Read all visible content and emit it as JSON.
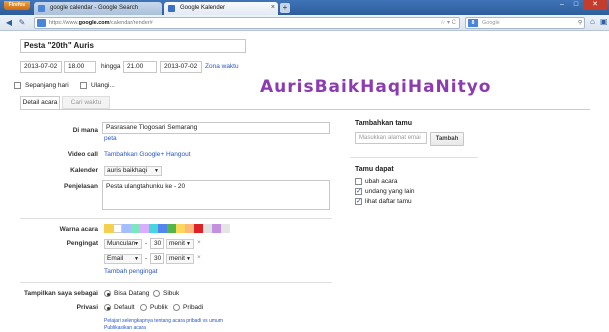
{
  "browser": {
    "firefox_label": "Firefox",
    "tabs": [
      {
        "title": "google calendar - Google Search"
      },
      {
        "title": "Google Kalender"
      }
    ],
    "url_prefix": "https://www.",
    "url_domain": "google.com",
    "url_path": "/calendar/render#",
    "search_placeholder": "Google",
    "search_engine_letter": "8"
  },
  "event": {
    "title": "Pesta \"20th\" Auris",
    "start_date": "2013-07-02",
    "start_time": "18.00",
    "until_label": "hingga",
    "end_time": "21.00",
    "end_date": "2013-07-02",
    "timezone_link": "Zona waktu",
    "allday_label": "Sepanjang hari",
    "repeat_label": "Ulangi...",
    "watermark": "AurisBaikHaqiHaNityo"
  },
  "tabs": {
    "details": "Detail acara",
    "findtime": "Cari waktu"
  },
  "details": {
    "where_label": "Di mana",
    "where_value": "Pasrasane Tlogosari Semarang",
    "map_link": "peta",
    "video_label": "Video call",
    "video_link": "Tambahkan Google+ Hangout",
    "calendar_label": "Kalender",
    "calendar_value": "auris baikhaqi",
    "description_label": "Penjelasan",
    "description_value": "Pesta ulangtahunku ke - 20",
    "color_label": "Warna acara",
    "reminder_label": "Pengingat",
    "reminders": [
      {
        "type": "Munculan",
        "amount": "30",
        "unit": "menit"
      },
      {
        "type": "Email",
        "amount": "30",
        "unit": "menit"
      }
    ],
    "add_reminder_link": "Tambah pengingat",
    "show_as_label": "Tampilkan saya sebagai",
    "show_available": "Bisa Datang",
    "show_busy": "Sibuk",
    "privacy_label": "Privasi",
    "privacy_default": "Default",
    "privacy_public": "Publik",
    "privacy_private": "Pribadi",
    "privacy_note_1": "Pelajari selengkapnya tentang acara pribadi vs umum",
    "privacy_note_2": "Publikasikan acara"
  },
  "guests": {
    "heading": "Tambahkan tamu",
    "input_placeholder": "Masukkan alamat emai",
    "add_button": "Tambah",
    "can_heading": "Tamu dapat",
    "options": [
      {
        "label": "ubah acara",
        "checked": false
      },
      {
        "label": "undang yang lain",
        "checked": true
      },
      {
        "label": "lihat daftar tamu",
        "checked": true
      }
    ]
  },
  "colors": {
    "swatches": [
      "#f5d04c",
      "#ffffff",
      "#a4bdfc",
      "#7ae7bf",
      "#dbadff",
      "#46d6db",
      "#5484ed",
      "#51b749",
      "#fbd75b",
      "#ffb878",
      "#dc2127",
      "#e1e1e1",
      "#c38fe0",
      "#e5e5e5"
    ],
    "accent_link": "#2a56c6",
    "watermark": "#8b3cb0"
  }
}
